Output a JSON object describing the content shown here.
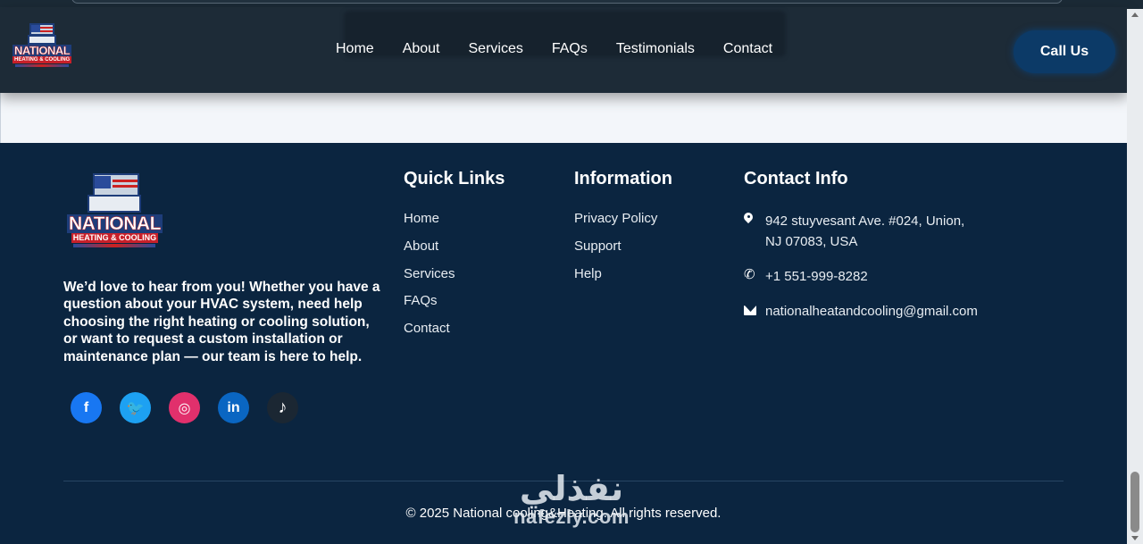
{
  "header": {
    "logo": {
      "name": "NATIONAL",
      "sub": "HEATING & COOLING"
    },
    "nav": [
      "Home",
      "About",
      "Services",
      "FAQs",
      "Testimonials",
      "Contact"
    ],
    "call_label": "Call Us"
  },
  "footer": {
    "logo": {
      "name": "NATIONAL",
      "sub": "HEATING & COOLING"
    },
    "about_text": "We’d love to hear from you! Whether you have a question about your HVAC system, need help choosing the right heating or cooling solution, or want to request a custom installation or maintenance plan — our team is here to help.",
    "socials": [
      {
        "name": "facebook",
        "glyph": "f"
      },
      {
        "name": "twitter",
        "glyph": "🐦"
      },
      {
        "name": "instagram",
        "glyph": "◎"
      },
      {
        "name": "linkedin",
        "glyph": "in"
      },
      {
        "name": "tiktok",
        "glyph": "♪"
      }
    ],
    "quick_links": {
      "title": "Quick Links",
      "items": [
        "Home",
        "About",
        "Services",
        "FAQs",
        "Contact"
      ]
    },
    "information": {
      "title": "Information",
      "items": [
        "Privacy Policy",
        "Support",
        "Help"
      ]
    },
    "contact": {
      "title": "Contact Info",
      "address": "942 stuyvesant Ave. #024, Union, NJ 07083, USA",
      "phone": "+1 551-999-8282",
      "email": "nationalheatandcooling@gmail.com"
    },
    "copyright": "© 2025 National cooling&Heating. All rights reserved."
  },
  "watermark": {
    "arabic": "نفذلي",
    "latin": "nafezly.com"
  },
  "colors": {
    "footer_bg": "#0b2540",
    "header_bg": "#1d2b37",
    "call_button": "#0c3a67"
  }
}
